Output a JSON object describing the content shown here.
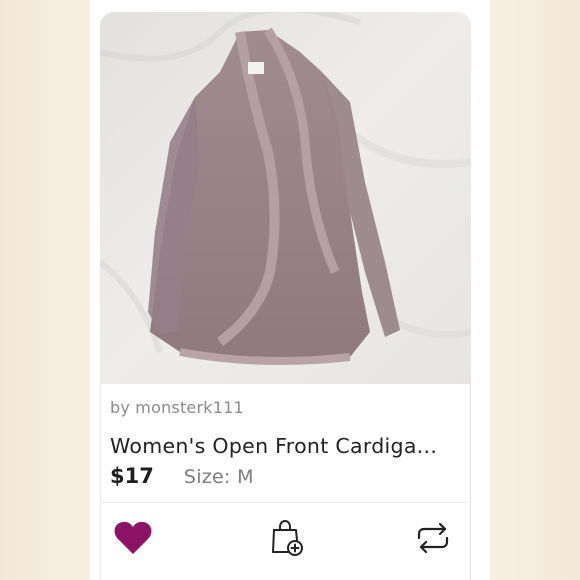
{
  "listing": {
    "seller_line": "by monsterk111",
    "title": "Women's Open Front Cardiga...",
    "price": "$17",
    "size_text": "Size: M"
  },
  "actions": {
    "like_icon": "heart-icon",
    "bundle_icon": "shopping-bag-add-icon",
    "share_icon": "share-repost-icon"
  },
  "colors": {
    "like_active": "#8c1266",
    "icon_stroke": "#222222"
  }
}
